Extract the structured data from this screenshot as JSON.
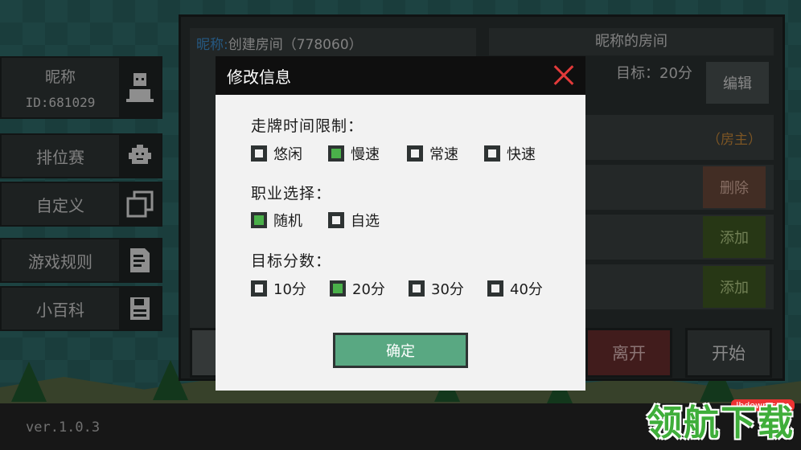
{
  "profile": {
    "nickname": "昵称",
    "id": "ID:681029"
  },
  "menu": {
    "ranked": "排位赛",
    "custom": "自定义",
    "rules": "游戏规则",
    "wiki": "小百科"
  },
  "version": "ver.1.0.3",
  "room": {
    "nick_key": "昵称:",
    "name": "创建房间（778060）",
    "right_title": "昵称的房间",
    "target": "目标：20分",
    "edit": "编辑",
    "host": "（房主）",
    "delete": "删除",
    "add1": "添加",
    "add2": "添加",
    "leave": "离开",
    "start": "开始"
  },
  "modal": {
    "title": "修改信息",
    "time_limit_title": "走牌时间限制：",
    "time_options": [
      {
        "label": "悠闲",
        "checked": false
      },
      {
        "label": "慢速",
        "checked": true
      },
      {
        "label": "常速",
        "checked": false
      },
      {
        "label": "快速",
        "checked": false
      }
    ],
    "job_title": "职业选择：",
    "job_options": [
      {
        "label": "随机",
        "checked": true
      },
      {
        "label": "自选",
        "checked": false
      }
    ],
    "score_title": "目标分数：",
    "score_options": [
      {
        "label": "10分",
        "checked": false
      },
      {
        "label": "20分",
        "checked": true
      },
      {
        "label": "30分",
        "checked": false
      },
      {
        "label": "40分",
        "checked": false
      }
    ],
    "confirm": "确定"
  },
  "watermark": {
    "text": "领航下载",
    "url": "lhdown.com"
  },
  "colors": {
    "checked": "#4ab04a",
    "confirm": "#59a882",
    "close": "#e23a3a",
    "leave": "#6a2e2e",
    "add": "#3f5a22"
  }
}
